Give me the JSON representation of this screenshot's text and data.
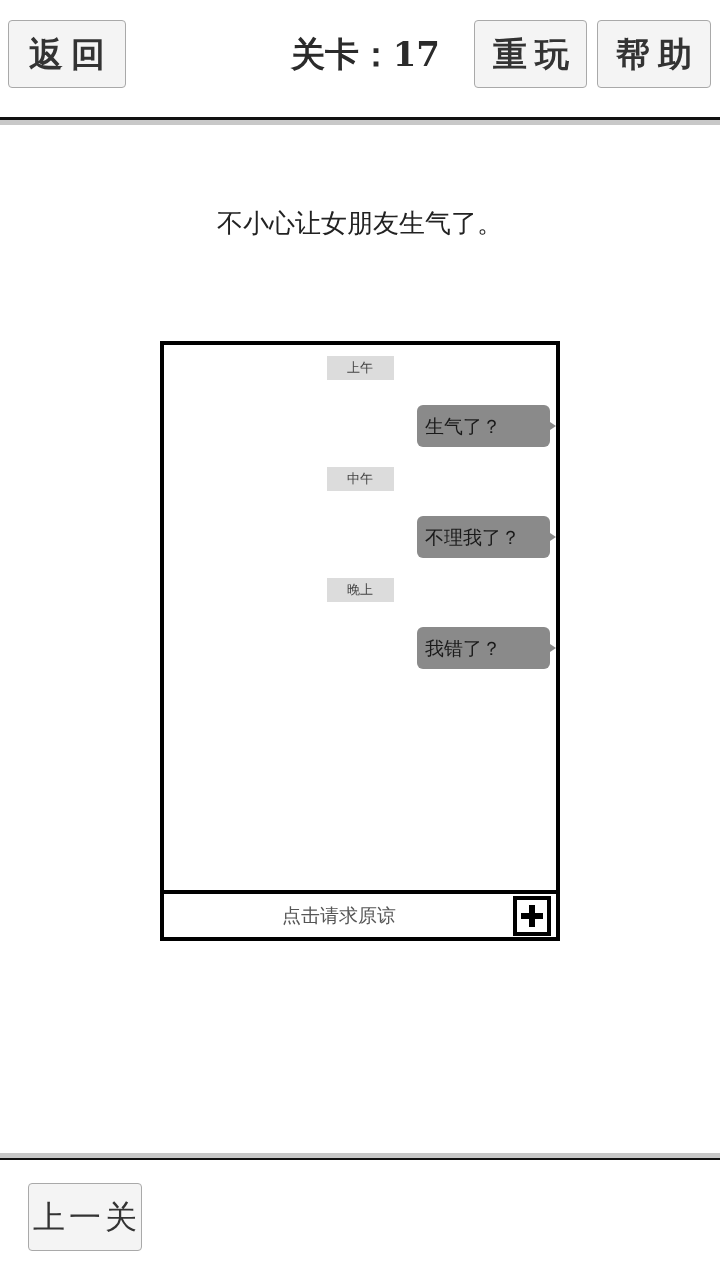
{
  "header": {
    "back_button": "返回",
    "level_label": "关卡：17",
    "buttons": [
      "重玩",
      "帮助"
    ]
  },
  "prompt": "不小心让女朋友生气了。",
  "chat": {
    "messages": [
      {
        "kind": "time",
        "text": "上午"
      },
      {
        "kind": "bubble",
        "text": "生气了？"
      },
      {
        "kind": "time",
        "text": "中午"
      },
      {
        "kind": "bubble",
        "text": "不理我了？"
      },
      {
        "kind": "time",
        "text": "晚上"
      },
      {
        "kind": "bubble",
        "text": "我错了？"
      }
    ],
    "action_bar": {
      "label": "点击请求原谅"
    }
  },
  "footer": {
    "prev_button": "上一关"
  }
}
